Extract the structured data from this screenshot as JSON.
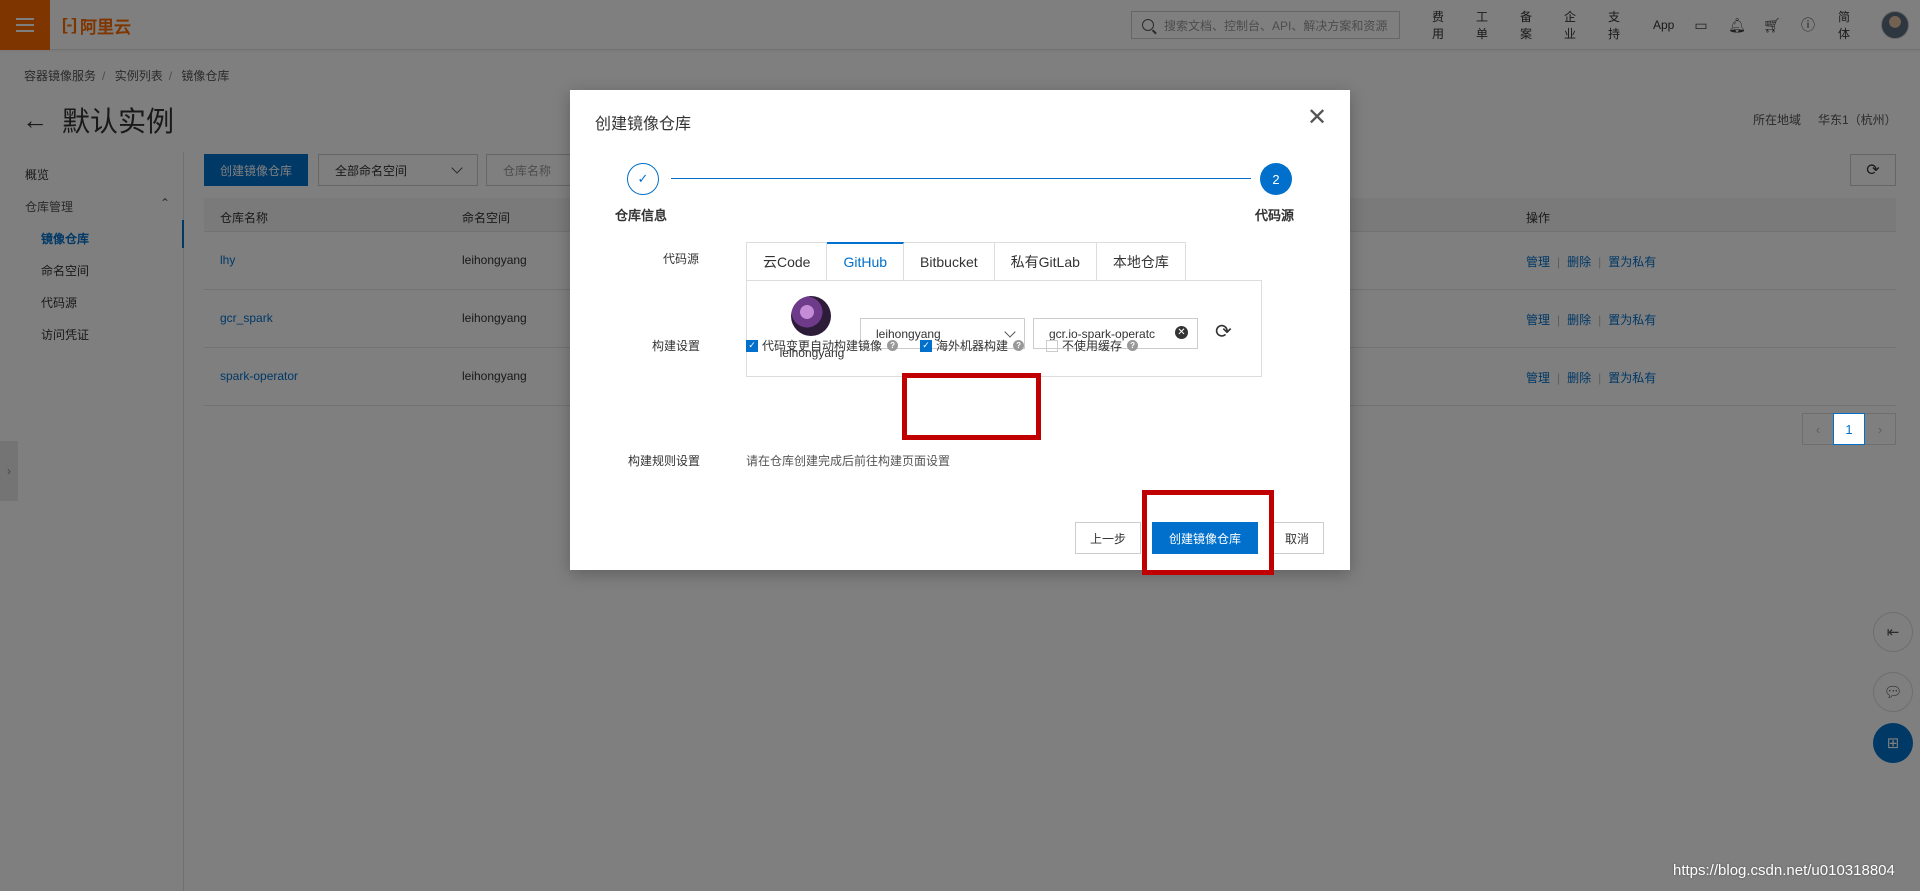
{
  "topbar": {
    "brand": "阿里云",
    "search_placeholder": "搜索文档、控制台、API、解决方案和资源",
    "nav": [
      "费用",
      "工单",
      "备案",
      "企业",
      "支持",
      "App"
    ],
    "lang": "简体",
    "icons": [
      "terminal-icon",
      "bell-icon",
      "cart-icon",
      "help-icon"
    ]
  },
  "breadcrumb": [
    "容器镜像服务",
    "实例列表",
    "镜像仓库"
  ],
  "page": {
    "title": "默认实例",
    "region_label": "所在地域",
    "region_value": "华东1（杭州）"
  },
  "sidebar": {
    "overview": "概览",
    "group": "仓库管理",
    "items": [
      "镜像仓库",
      "命名空间",
      "代码源",
      "访问凭证"
    ]
  },
  "toolbar": {
    "create_button": "创建镜像仓库",
    "namespace_select": "全部命名空间",
    "search_placeholder": "仓库名称"
  },
  "table": {
    "columns": [
      "仓库名称",
      "命名空间",
      "操作"
    ],
    "rows": [
      {
        "name": "lhy",
        "namespace": "leihongyang"
      },
      {
        "name": "gcr_spark",
        "namespace": "leihongyang"
      },
      {
        "name": "spark-operator",
        "namespace": "leihongyang"
      }
    ],
    "actions": [
      "管理",
      "删除",
      "置为私有"
    ],
    "page": "1"
  },
  "modal": {
    "title": "创建镜像仓库",
    "steps": [
      {
        "label": "仓库信息",
        "marker": "✓"
      },
      {
        "label": "代码源",
        "marker": "2"
      }
    ],
    "code_source_label": "代码源",
    "tabs": [
      "云Code",
      "GitHub",
      "Bitbucket",
      "私有GitLab",
      "本地仓库"
    ],
    "active_tab": "GitHub",
    "account_name": "leihongyang",
    "org_select": "leihongyang",
    "repo_value": "gcr.io-spark-operatc",
    "build_settings_label": "构建设置",
    "build_options": [
      {
        "label": "代码变更自动构建镜像",
        "checked": true
      },
      {
        "label": "海外机器构建",
        "checked": true
      },
      {
        "label": "不使用缓存",
        "checked": false
      }
    ],
    "build_rules_label": "构建规则设置",
    "build_rules_text": "请在仓库创建完成后前往构建页面设置",
    "buttons": {
      "prev": "上一步",
      "create": "创建镜像仓库",
      "cancel": "取消"
    }
  },
  "colors": {
    "brand": "#ff6a00",
    "primary": "#0070cc",
    "highlight": "#c00000"
  },
  "watermark": "https://blog.csdn.net/u010318804"
}
